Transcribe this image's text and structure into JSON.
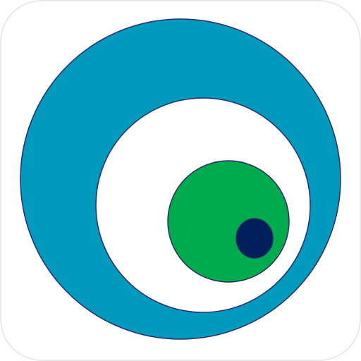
{
  "app_icon": {
    "icon_name": "nested-circles-eye-logo-icon",
    "colors": {
      "tile_background": "#ffffff",
      "tile_border": "#e3e3e3",
      "outer_ring": "#019ABF",
      "inner_disc": "#ffffff",
      "iris": "#00AB4E",
      "pupil": "#011F5B",
      "outline": "#2B2A6B"
    }
  }
}
